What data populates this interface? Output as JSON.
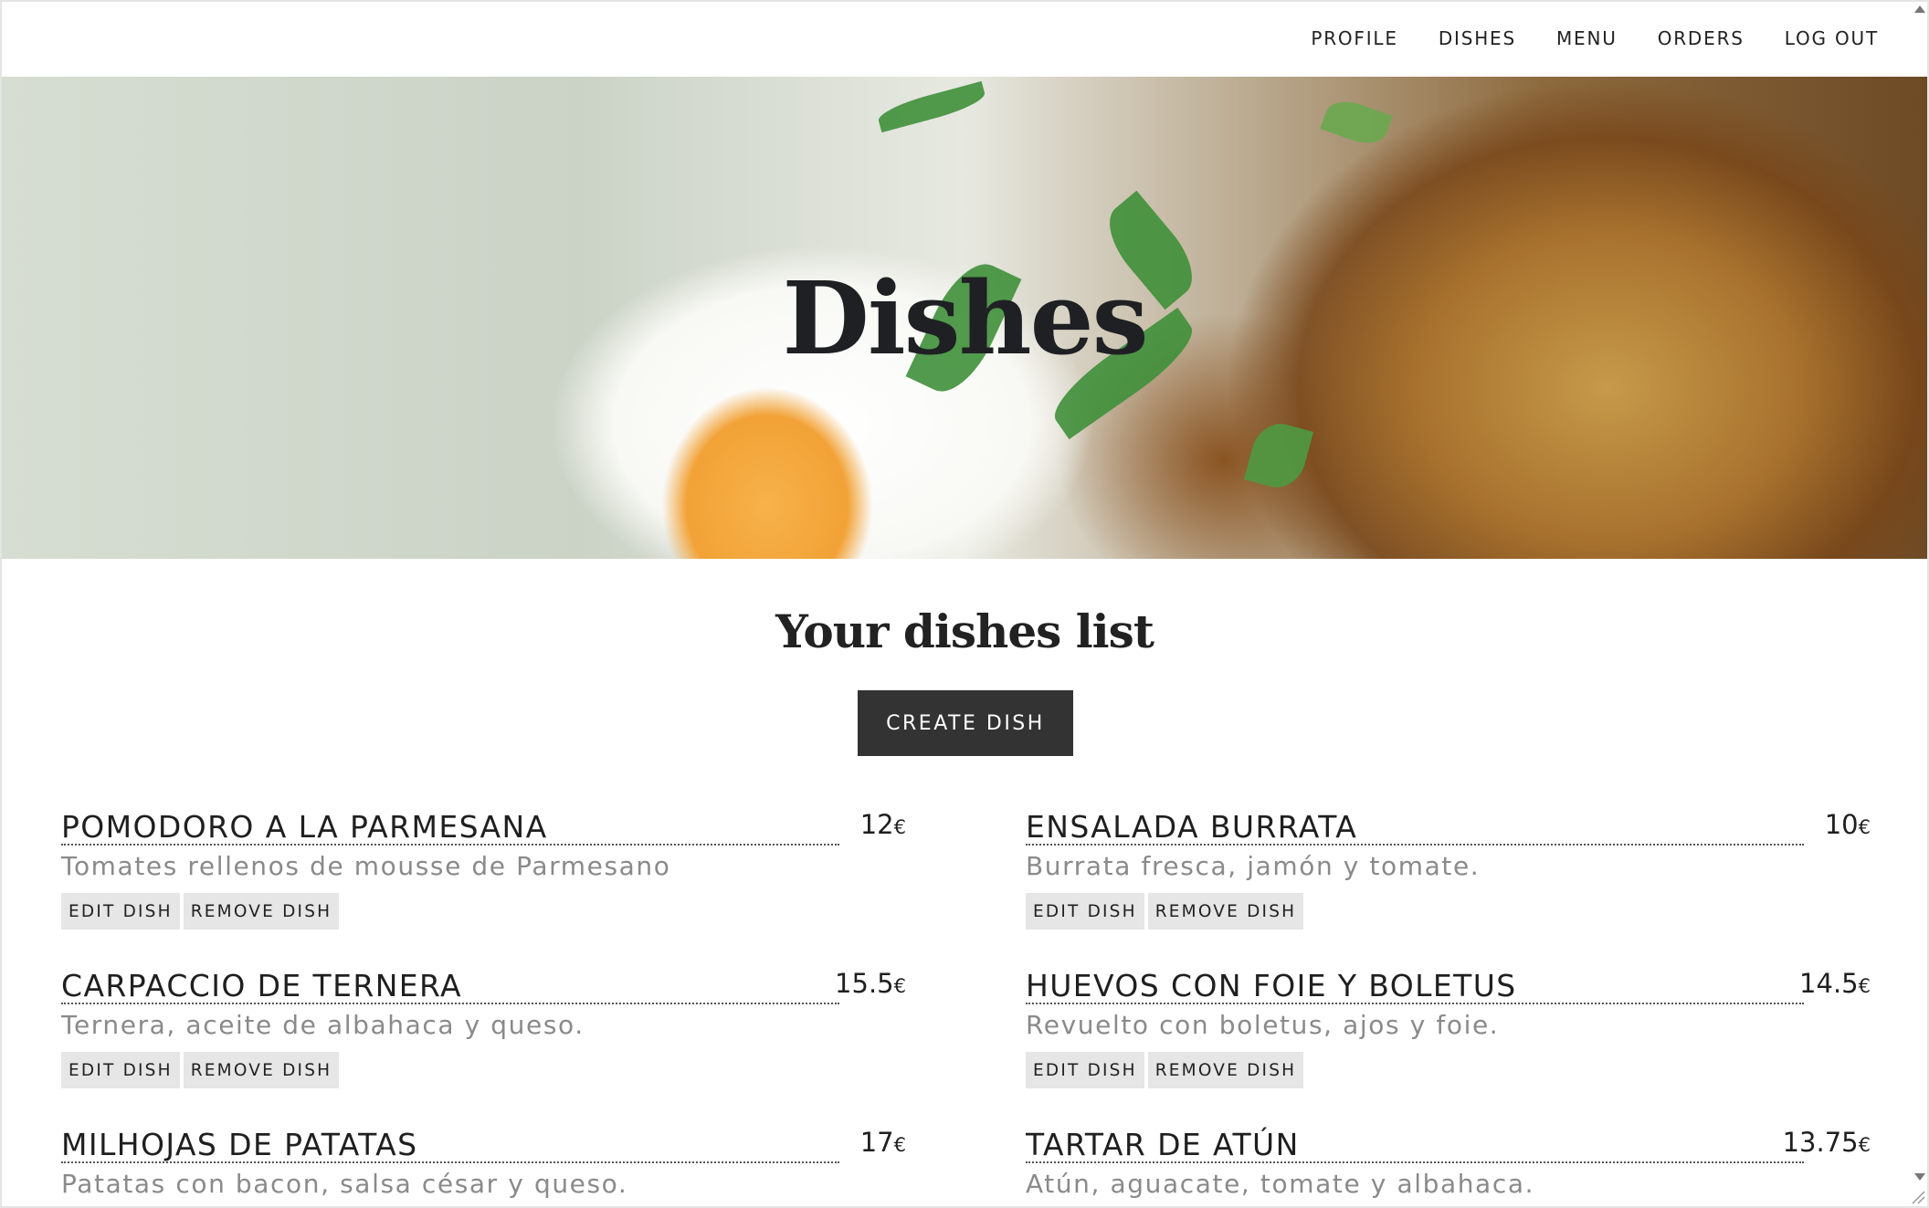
{
  "nav": {
    "items": [
      {
        "label": "PROFILE"
      },
      {
        "label": "DISHES"
      },
      {
        "label": "MENU"
      },
      {
        "label": "ORDERS"
      },
      {
        "label": "LOG OUT"
      }
    ]
  },
  "hero": {
    "title": "Dishes"
  },
  "list": {
    "title": "Your dishes list",
    "create_label": "CREATE DISH",
    "currency": "€",
    "edit_label": "EDIT DISH",
    "remove_label": "REMOVE DISH"
  },
  "dishes": [
    {
      "name": "POMODORO A LA PARMESANA",
      "price": "12",
      "description": "Tomates rellenos de mousse de Parmesano"
    },
    {
      "name": "ENSALADA BURRATA",
      "price": "10",
      "description": "Burrata fresca, jamón y tomate."
    },
    {
      "name": "CARPACCIO DE TERNERA",
      "price": "15.5",
      "description": "Ternera, aceite de albahaca y queso."
    },
    {
      "name": "HUEVOS CON FOIE Y BOLETUS",
      "price": "14.5",
      "description": "Revuelto con boletus, ajos y foie."
    },
    {
      "name": "MILHOJAS DE PATATAS",
      "price": "17",
      "description": "Patatas con bacon, salsa césar y queso."
    },
    {
      "name": "TARTAR DE ATÚN",
      "price": "13.75",
      "description": "Atún, aguacate, tomate y albahaca."
    }
  ]
}
